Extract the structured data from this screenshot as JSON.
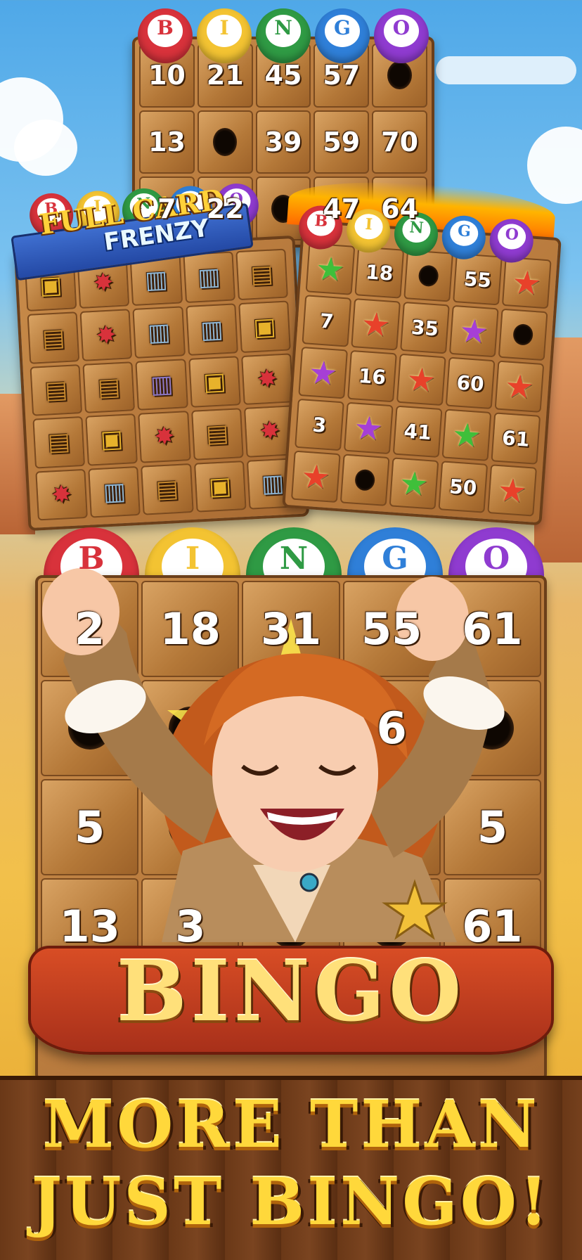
{
  "colors": {
    "b": "#d8323b",
    "i": "#f3c332",
    "n": "#2f9a44",
    "g": "#2f7fd8",
    "o": "#8f3bd0",
    "gold": "#ffd83b",
    "ribbon": "#c23a1d",
    "wood": "#b47838"
  },
  "bingo_letters": [
    "B",
    "I",
    "N",
    "G",
    "O"
  ],
  "card_top": {
    "rows": [
      [
        "10",
        "21",
        "45",
        "57",
        ""
      ],
      [
        "13",
        "",
        "39",
        "59",
        "70"
      ],
      [
        "7",
        "22",
        "",
        "47",
        "64"
      ]
    ]
  },
  "full_card_frenzy": {
    "title_line1": "FULL CARD",
    "title_line2": "FRENZY",
    "rows": [
      [
        "treasure-chest",
        "dynamite",
        "silver-barrel",
        "silver-barrel",
        "wooden-barrel"
      ],
      [
        "wooden-barrel",
        "dynamite",
        "silver-barrel",
        "silver-barrel",
        "treasure-chest"
      ],
      [
        "wooden-barrel",
        "wooden-barrel",
        "purple-barrel",
        "treasure-chest",
        "dynamite"
      ],
      [
        "wooden-barrel",
        "treasure-chest",
        "dynamite",
        "wooden-barrel",
        "dynamite"
      ],
      [
        "dynamite",
        "silver-barrel",
        "wooden-barrel",
        "treasure-chest",
        "silver-barrel"
      ]
    ]
  },
  "fire_card": {
    "rows": [
      [
        "green-star",
        "18",
        "hole",
        "55",
        "red-star"
      ],
      [
        "7",
        "red-star",
        "35",
        "purple-star",
        "hole"
      ],
      [
        "purple-star",
        "16",
        "red-star",
        "60",
        "red-star"
      ],
      [
        "3",
        "purple-star",
        "41",
        "green-star",
        "61"
      ],
      [
        "red-star",
        "hole",
        "green-star",
        "50",
        "red-star"
      ]
    ]
  },
  "main_card": {
    "rows": [
      [
        "2",
        "18",
        "31",
        "55",
        "61"
      ],
      [
        "",
        "",
        "",
        "6",
        ""
      ],
      [
        "5",
        "",
        "",
        "",
        "5"
      ],
      [
        "13",
        "3",
        "",
        "",
        "61"
      ]
    ]
  },
  "banner_text": "BINGO",
  "tagline_line1": "MORE THAN",
  "tagline_line2": "JUST BINGO!",
  "icons": {
    "treasure-chest": "▣",
    "dynamite": "✸",
    "silver-barrel": "▥",
    "wooden-barrel": "▤",
    "purple-barrel": "▥",
    "red-star": "★",
    "green-star": "★",
    "purple-star": "★"
  }
}
